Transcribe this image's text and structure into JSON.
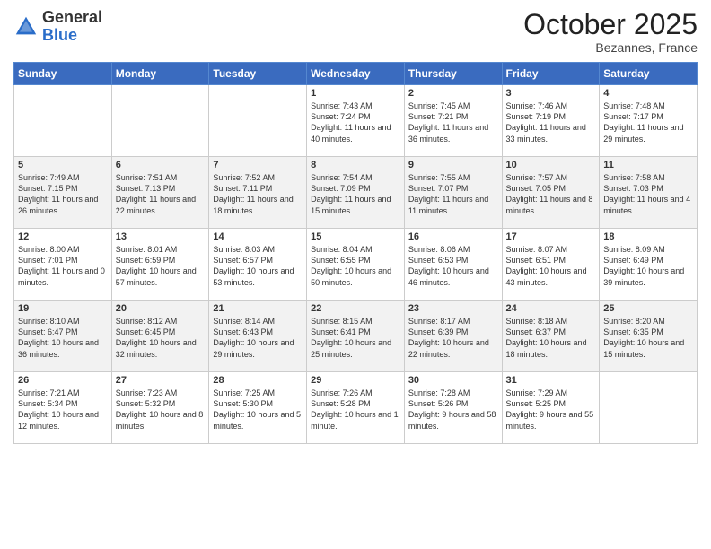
{
  "header": {
    "logo_general": "General",
    "logo_blue": "Blue",
    "month": "October 2025",
    "location": "Bezannes, France"
  },
  "days_of_week": [
    "Sunday",
    "Monday",
    "Tuesday",
    "Wednesday",
    "Thursday",
    "Friday",
    "Saturday"
  ],
  "weeks": [
    [
      {
        "num": "",
        "info": ""
      },
      {
        "num": "",
        "info": ""
      },
      {
        "num": "",
        "info": ""
      },
      {
        "num": "1",
        "info": "Sunrise: 7:43 AM\nSunset: 7:24 PM\nDaylight: 11 hours and 40 minutes."
      },
      {
        "num": "2",
        "info": "Sunrise: 7:45 AM\nSunset: 7:21 PM\nDaylight: 11 hours and 36 minutes."
      },
      {
        "num": "3",
        "info": "Sunrise: 7:46 AM\nSunset: 7:19 PM\nDaylight: 11 hours and 33 minutes."
      },
      {
        "num": "4",
        "info": "Sunrise: 7:48 AM\nSunset: 7:17 PM\nDaylight: 11 hours and 29 minutes."
      }
    ],
    [
      {
        "num": "5",
        "info": "Sunrise: 7:49 AM\nSunset: 7:15 PM\nDaylight: 11 hours and 26 minutes."
      },
      {
        "num": "6",
        "info": "Sunrise: 7:51 AM\nSunset: 7:13 PM\nDaylight: 11 hours and 22 minutes."
      },
      {
        "num": "7",
        "info": "Sunrise: 7:52 AM\nSunset: 7:11 PM\nDaylight: 11 hours and 18 minutes."
      },
      {
        "num": "8",
        "info": "Sunrise: 7:54 AM\nSunset: 7:09 PM\nDaylight: 11 hours and 15 minutes."
      },
      {
        "num": "9",
        "info": "Sunrise: 7:55 AM\nSunset: 7:07 PM\nDaylight: 11 hours and 11 minutes."
      },
      {
        "num": "10",
        "info": "Sunrise: 7:57 AM\nSunset: 7:05 PM\nDaylight: 11 hours and 8 minutes."
      },
      {
        "num": "11",
        "info": "Sunrise: 7:58 AM\nSunset: 7:03 PM\nDaylight: 11 hours and 4 minutes."
      }
    ],
    [
      {
        "num": "12",
        "info": "Sunrise: 8:00 AM\nSunset: 7:01 PM\nDaylight: 11 hours and 0 minutes."
      },
      {
        "num": "13",
        "info": "Sunrise: 8:01 AM\nSunset: 6:59 PM\nDaylight: 10 hours and 57 minutes."
      },
      {
        "num": "14",
        "info": "Sunrise: 8:03 AM\nSunset: 6:57 PM\nDaylight: 10 hours and 53 minutes."
      },
      {
        "num": "15",
        "info": "Sunrise: 8:04 AM\nSunset: 6:55 PM\nDaylight: 10 hours and 50 minutes."
      },
      {
        "num": "16",
        "info": "Sunrise: 8:06 AM\nSunset: 6:53 PM\nDaylight: 10 hours and 46 minutes."
      },
      {
        "num": "17",
        "info": "Sunrise: 8:07 AM\nSunset: 6:51 PM\nDaylight: 10 hours and 43 minutes."
      },
      {
        "num": "18",
        "info": "Sunrise: 8:09 AM\nSunset: 6:49 PM\nDaylight: 10 hours and 39 minutes."
      }
    ],
    [
      {
        "num": "19",
        "info": "Sunrise: 8:10 AM\nSunset: 6:47 PM\nDaylight: 10 hours and 36 minutes."
      },
      {
        "num": "20",
        "info": "Sunrise: 8:12 AM\nSunset: 6:45 PM\nDaylight: 10 hours and 32 minutes."
      },
      {
        "num": "21",
        "info": "Sunrise: 8:14 AM\nSunset: 6:43 PM\nDaylight: 10 hours and 29 minutes."
      },
      {
        "num": "22",
        "info": "Sunrise: 8:15 AM\nSunset: 6:41 PM\nDaylight: 10 hours and 25 minutes."
      },
      {
        "num": "23",
        "info": "Sunrise: 8:17 AM\nSunset: 6:39 PM\nDaylight: 10 hours and 22 minutes."
      },
      {
        "num": "24",
        "info": "Sunrise: 8:18 AM\nSunset: 6:37 PM\nDaylight: 10 hours and 18 minutes."
      },
      {
        "num": "25",
        "info": "Sunrise: 8:20 AM\nSunset: 6:35 PM\nDaylight: 10 hours and 15 minutes."
      }
    ],
    [
      {
        "num": "26",
        "info": "Sunrise: 7:21 AM\nSunset: 5:34 PM\nDaylight: 10 hours and 12 minutes."
      },
      {
        "num": "27",
        "info": "Sunrise: 7:23 AM\nSunset: 5:32 PM\nDaylight: 10 hours and 8 minutes."
      },
      {
        "num": "28",
        "info": "Sunrise: 7:25 AM\nSunset: 5:30 PM\nDaylight: 10 hours and 5 minutes."
      },
      {
        "num": "29",
        "info": "Sunrise: 7:26 AM\nSunset: 5:28 PM\nDaylight: 10 hours and 1 minute."
      },
      {
        "num": "30",
        "info": "Sunrise: 7:28 AM\nSunset: 5:26 PM\nDaylight: 9 hours and 58 minutes."
      },
      {
        "num": "31",
        "info": "Sunrise: 7:29 AM\nSunset: 5:25 PM\nDaylight: 9 hours and 55 minutes."
      },
      {
        "num": "",
        "info": ""
      }
    ]
  ]
}
